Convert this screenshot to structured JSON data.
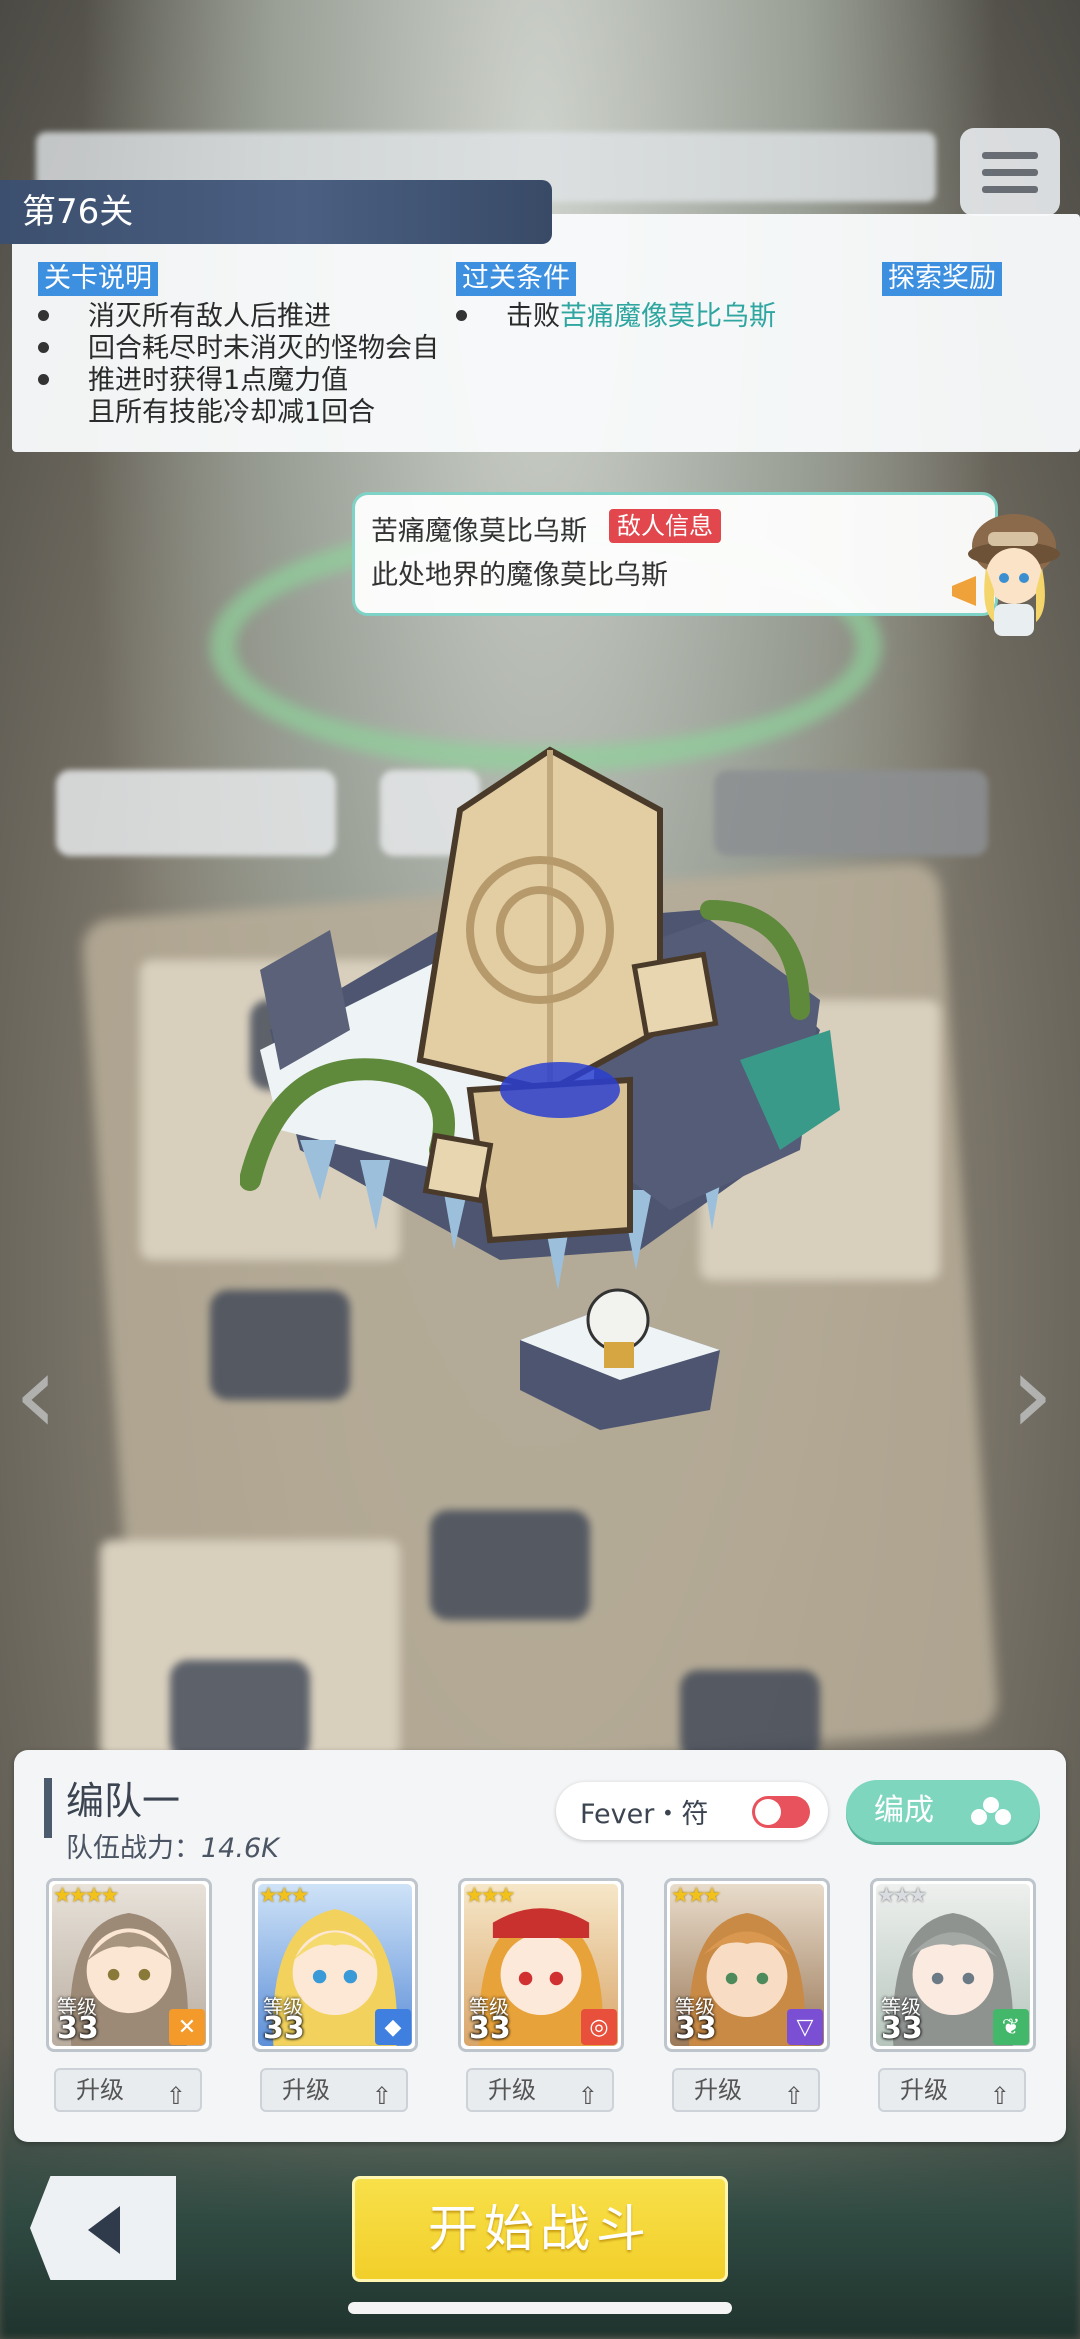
{
  "stage": {
    "title": "第76关",
    "desc_label": "关卡说明",
    "desc_lines": [
      "消灭所有敌人后推进",
      "回合耗尽时未消灭的怪物会自",
      "推进时获得1点魔力值",
      "且所有技能冷却减1回合"
    ],
    "clear_label": "过关条件",
    "clear_prefix": "击败",
    "clear_target": "苦痛魔像莫比乌斯",
    "reward_label": "探索奖励"
  },
  "enemy": {
    "name": "苦痛魔像莫比乌斯",
    "badge": "敌人信息",
    "desc": "此处地界的魔像莫比乌斯"
  },
  "team": {
    "name": "编队一",
    "power_label": "队伍战力：",
    "power_value": "14.6K",
    "fever_label": "Fever・符",
    "formation_label": "编成",
    "level_label": "等级",
    "upgrade_label": "升级",
    "members": [
      {
        "stars": "★★★★",
        "level": "33",
        "class_icon": "cross-icon",
        "class_color": "#f39a2a",
        "portrait": "brown-hair-girl"
      },
      {
        "stars": "★★★",
        "level": "33",
        "class_icon": "diamond-icon",
        "class_color": "#3f7fe0",
        "portrait": "blonde-girl"
      },
      {
        "stars": "★★★",
        "level": "33",
        "class_icon": "target-icon",
        "class_color": "#e8503c",
        "portrait": "red-eyed-girl"
      },
      {
        "stars": "★★★",
        "level": "33",
        "class_icon": "triangle-icon",
        "class_color": "#7a4fd4",
        "portrait": "orange-hair-boy"
      },
      {
        "stars": "★★★",
        "level": "33",
        "class_icon": "leaf-icon",
        "class_color": "#43b86a",
        "portrait": "grey-hair-girl"
      }
    ]
  },
  "actions": {
    "start_label": "开始战斗"
  },
  "colors": {
    "accent_blue": "#3d8fe0",
    "highlight_teal": "#2fa6a0",
    "start_yellow": "#f5d733",
    "formation_green": "#7fd6bf",
    "badge_red": "#e2474e"
  }
}
